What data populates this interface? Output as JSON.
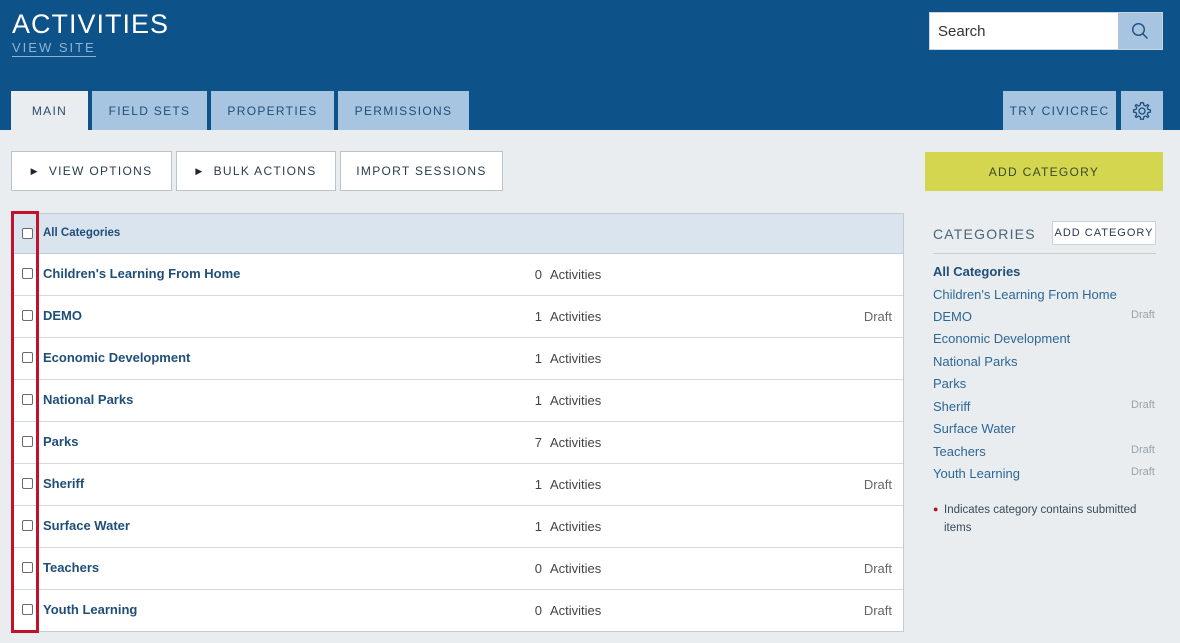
{
  "header": {
    "title": "ACTIVITIES",
    "view_site": "VIEW SITE",
    "search_placeholder": "Search",
    "tabs": [
      {
        "label": "MAIN"
      },
      {
        "label": "FIELD SETS"
      },
      {
        "label": "PROPERTIES"
      },
      {
        "label": "PERMISSIONS"
      }
    ],
    "try_label": "TRY CIVICREC"
  },
  "toolbar": {
    "view_options": "VIEW OPTIONS",
    "bulk_actions": "BULK ACTIONS",
    "import_sessions": "IMPORT SESSIONS",
    "add_category": "ADD CATEGORY"
  },
  "table": {
    "header_label": "All Categories",
    "count_suffix": "Activities",
    "rows": [
      {
        "name": "Children's Learning From Home",
        "count": "0",
        "status": ""
      },
      {
        "name": "DEMO",
        "count": "1",
        "status": "Draft"
      },
      {
        "name": "Economic Development",
        "count": "1",
        "status": ""
      },
      {
        "name": "National Parks",
        "count": "1",
        "status": ""
      },
      {
        "name": "Parks",
        "count": "7",
        "status": ""
      },
      {
        "name": "Sheriff",
        "count": "1",
        "status": "Draft"
      },
      {
        "name": "Surface Water",
        "count": "1",
        "status": ""
      },
      {
        "name": "Teachers",
        "count": "0",
        "status": "Draft"
      },
      {
        "name": "Youth Learning",
        "count": "0",
        "status": "Draft"
      }
    ]
  },
  "sidebar": {
    "title": "CATEGORIES",
    "add_label": "ADD CATEGORY",
    "items": [
      {
        "label": "All Categories",
        "status": ""
      },
      {
        "label": "Children's Learning From Home",
        "status": ""
      },
      {
        "label": "DEMO",
        "status": "Draft"
      },
      {
        "label": "Economic Development",
        "status": ""
      },
      {
        "label": "National Parks",
        "status": ""
      },
      {
        "label": "Parks",
        "status": ""
      },
      {
        "label": "Sheriff",
        "status": "Draft"
      },
      {
        "label": "Surface Water",
        "status": ""
      },
      {
        "label": "Teachers",
        "status": "Draft"
      },
      {
        "label": "Youth Learning",
        "status": "Draft"
      }
    ],
    "note": "Indicates category contains submitted items",
    "note_bullet": "●"
  },
  "icons": {
    "search": "search-icon",
    "gear": "gear-icon",
    "expand": "triangle-right-icon"
  },
  "colors": {
    "header_bg": "#0d5288",
    "tab_bg": "#a7c4e0",
    "add_button": "#d4d64f",
    "link": "#1f4e79",
    "highlight": "#c0122b"
  }
}
